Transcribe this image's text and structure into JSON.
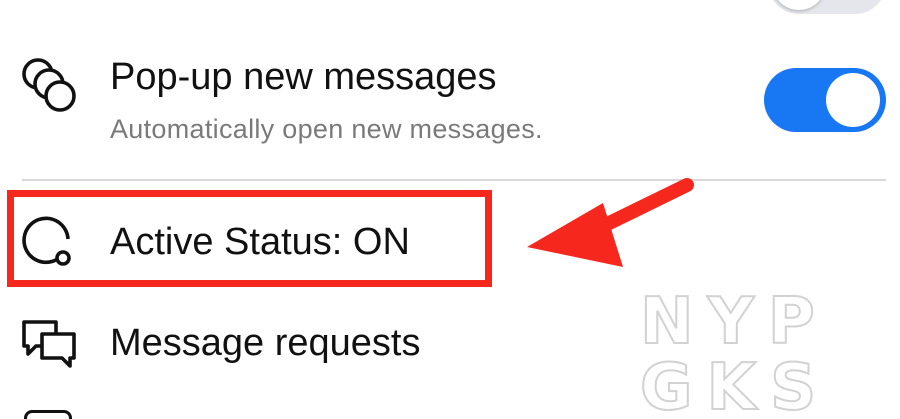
{
  "settings": {
    "popup": {
      "title": "Pop-up new messages",
      "subtitle": "Automatically open new messages.",
      "icon": "overlapping-circles-icon",
      "toggle_on": true
    },
    "active_status": {
      "title": "Active Status: ON",
      "icon": "active-status-icon"
    },
    "message_requests": {
      "title": "Message requests",
      "icon": "speech-bubbles-icon"
    }
  },
  "annotation": {
    "highlight_color": "#f6271c",
    "arrow_color": "#f6271c"
  },
  "watermark": {
    "line1": "NYP",
    "line2": "GKS"
  },
  "colors": {
    "toggle_on": "#1877f2",
    "toggle_off": "#e4e6eb"
  }
}
